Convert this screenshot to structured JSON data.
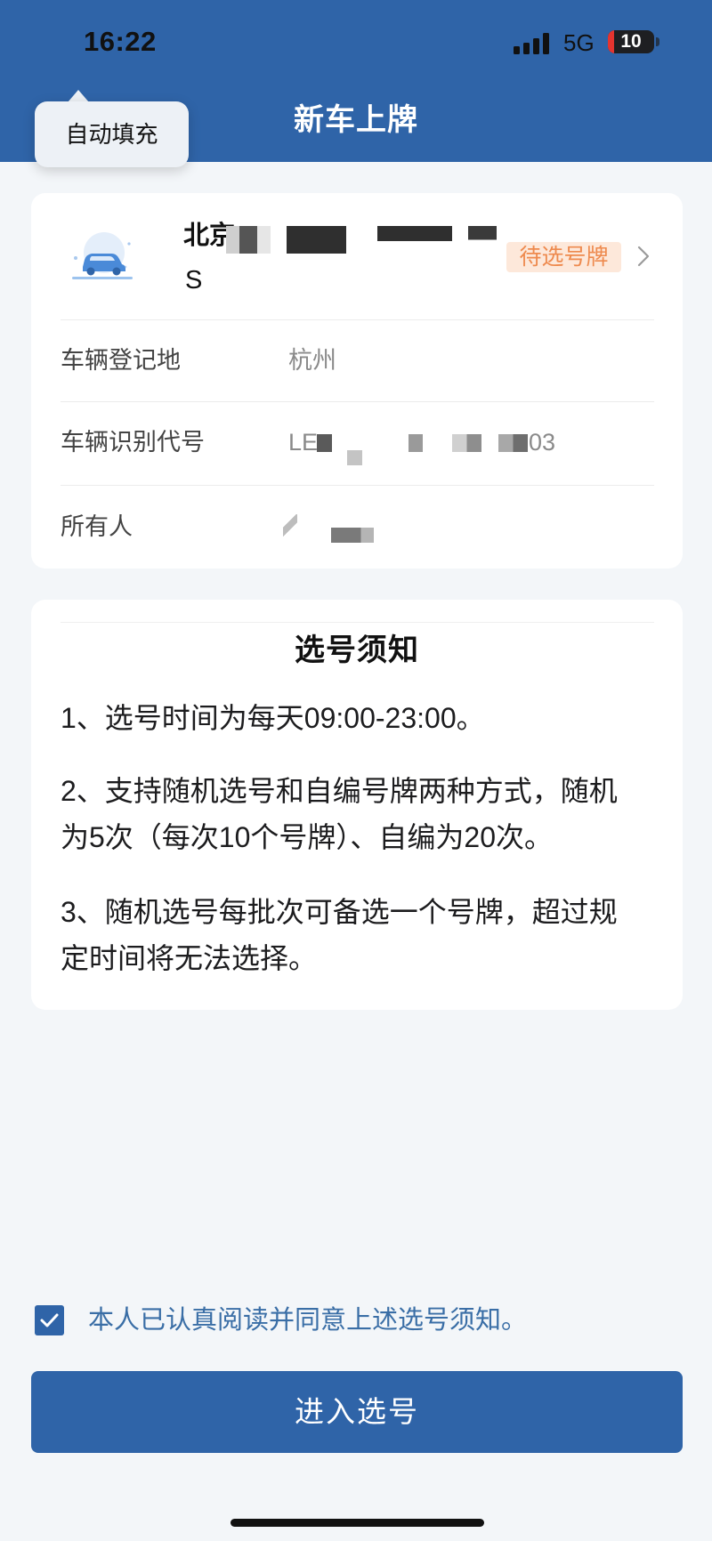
{
  "status_bar": {
    "time": "16:22",
    "network": "5G",
    "battery_level": "10",
    "signal_icon": "signal-bars-icon"
  },
  "autofill_tooltip": {
    "label": "自动填充"
  },
  "header": {
    "title": "新车上牌"
  },
  "vehicle_card": {
    "icon": "car-icon",
    "plate_line1": "北京",
    "plate_line2": "S",
    "status_badge": "待选号牌",
    "registration_place": {
      "label": "车辆登记地",
      "value": "杭州"
    },
    "vin": {
      "label": "车辆识别代号",
      "value_prefix": "LE",
      "value_suffix": "03"
    },
    "owner": {
      "label": "所有人"
    }
  },
  "notice_card": {
    "title": "选号须知",
    "items": [
      {
        "lines": [
          "1、选号时间为每天09:00-23:00。"
        ]
      },
      {
        "lines": [
          "2、支持随机选号和自编号牌两种方式，随机",
          "为5次（每次10个号牌）、自编为20次。"
        ]
      },
      {
        "lines": [
          "3、随机选号每批次可备选一个号牌，超过规",
          "定时间将无法选择。"
        ]
      }
    ]
  },
  "agreement": {
    "checked": true,
    "text": "本人已认真阅读并同意上述选号须知。"
  },
  "primary_button": {
    "label": "进入选号"
  },
  "colors": {
    "brand_blue": "#2f64a8",
    "badge_text": "#ee8a4e",
    "badge_bg": "#fde8da",
    "page_bg": "#f3f6f9",
    "agreement_text": "#3a6ea6"
  }
}
